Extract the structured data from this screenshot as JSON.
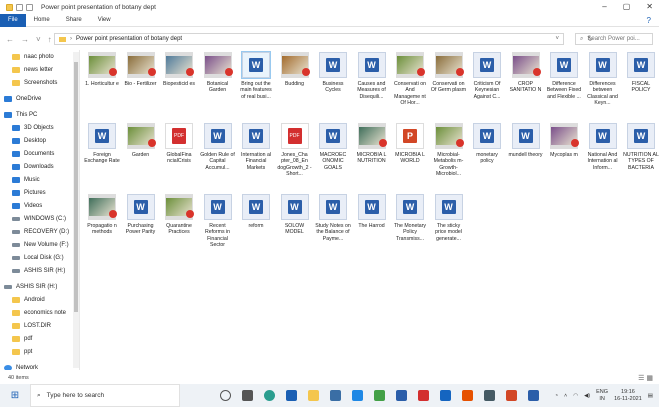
{
  "window": {
    "title": "Power point presentation of botany dept",
    "controls": [
      "–",
      "▢",
      "✕"
    ]
  },
  "ribbon": {
    "tabs": [
      "File",
      "Home",
      "Share",
      "View"
    ],
    "help": "?"
  },
  "address": {
    "path": "Power point presentation of botany dept",
    "search_placeholder": "Search Power poi..."
  },
  "sidebar": {
    "items": [
      {
        "label": "naac photo",
        "icon": "folder-icon"
      },
      {
        "label": "news letter",
        "icon": "folder-icon"
      },
      {
        "label": "Screenshots",
        "icon": "folder-icon"
      },
      {
        "label": "OneDrive",
        "icon": "cloud-icon"
      },
      {
        "label": "This PC",
        "icon": "pc-icon"
      },
      {
        "label": "3D Objects",
        "icon": "objects-icon"
      },
      {
        "label": "Desktop",
        "icon": "desktop-icon"
      },
      {
        "label": "Documents",
        "icon": "documents-icon"
      },
      {
        "label": "Downloads",
        "icon": "download-icon"
      },
      {
        "label": "Music",
        "icon": "music-icon"
      },
      {
        "label": "Pictures",
        "icon": "pictures-icon"
      },
      {
        "label": "Videos",
        "icon": "videos-icon"
      },
      {
        "label": "WINDOWS (C:)",
        "icon": "drive-icon"
      },
      {
        "label": "RECOVERY (D:)",
        "icon": "drive-icon"
      },
      {
        "label": "New Volume (F:)",
        "icon": "drive-icon"
      },
      {
        "label": "Local Disk (G:)",
        "icon": "drive-icon"
      },
      {
        "label": "ASHIS SIR (H:)",
        "icon": "drive-icon"
      },
      {
        "label": "ASHIS SIR (H:)",
        "icon": "drive-icon"
      },
      {
        "label": "Android",
        "icon": "folder-icon"
      },
      {
        "label": "economics note",
        "icon": "folder-icon"
      },
      {
        "label": "LOST.DIR",
        "icon": "folder-icon"
      },
      {
        "label": "pdf",
        "icon": "folder-icon"
      },
      {
        "label": "ppt",
        "icon": "folder-icon"
      },
      {
        "label": "Network",
        "icon": "network-icon"
      }
    ]
  },
  "files": [
    {
      "label": "1. Horticultur e",
      "type": "video"
    },
    {
      "label": "Bio - Fertilizer",
      "type": "video"
    },
    {
      "label": "Biopesticid es",
      "type": "video"
    },
    {
      "label": "Botanical Garden",
      "type": "video"
    },
    {
      "label": "Bring out the main features of real busi...",
      "type": "word"
    },
    {
      "label": "Budding",
      "type": "video"
    },
    {
      "label": "Business Cycles",
      "type": "word"
    },
    {
      "label": "Causes and Measures of Disequili...",
      "type": "word"
    },
    {
      "label": "Conservati on And Manageme nt Of Hor...",
      "type": "video"
    },
    {
      "label": "Conservati on Of Germ plasm",
      "type": "video"
    },
    {
      "label": "Criticism Of Keynesian Against C...",
      "type": "word"
    },
    {
      "label": "CROP SANITATIO N",
      "type": "video"
    },
    {
      "label": "Difference Between Fixed and Flexible ...",
      "type": "word"
    },
    {
      "label": "Differences between Classical and Keyn...",
      "type": "word"
    },
    {
      "label": "FISCAL POLICY",
      "type": "word"
    },
    {
      "label": "Foreign Exchange Rate",
      "type": "word"
    },
    {
      "label": "Garden",
      "type": "video"
    },
    {
      "label": "GlobalFina ncialCrisis",
      "type": "pdf"
    },
    {
      "label": "Golden Rule of Capital Accumul...",
      "type": "word"
    },
    {
      "label": "Internation al Financial Markets",
      "type": "word"
    },
    {
      "label": "Jones_Cha pter_08_En dogGrowth_2 - Short...",
      "type": "pdf"
    },
    {
      "label": "MACROEC ONOMIC GOALS",
      "type": "word"
    },
    {
      "label": "MICROBIA L NUTRITION",
      "type": "video"
    },
    {
      "label": "MICROBIA L WORLD",
      "type": "ppt"
    },
    {
      "label": "Microbial-Metabolis m-Growth-Microbiol...",
      "type": "video"
    },
    {
      "label": "monetary policy",
      "type": "word"
    },
    {
      "label": "mundell theory",
      "type": "word"
    },
    {
      "label": "Mycoplas m",
      "type": "video"
    },
    {
      "label": "National And Internation al Inform...",
      "type": "word"
    },
    {
      "label": "NUTRITION AL TYPES OF BACTERIA",
      "type": "word"
    },
    {
      "label": "Propagatio n methods",
      "type": "video"
    },
    {
      "label": "Purchasing Power Parity",
      "type": "word"
    },
    {
      "label": "Quarantine Practices",
      "type": "video"
    },
    {
      "label": "Recent Reforms in Financial Sector",
      "type": "word"
    },
    {
      "label": "reform",
      "type": "word"
    },
    {
      "label": "SOLOW MODEL",
      "type": "word"
    },
    {
      "label": "Study Notes on the Balance of Payme...",
      "type": "word"
    },
    {
      "label": "The Harrod",
      "type": "word"
    },
    {
      "label": "The Monetary Policy Transmiss...",
      "type": "word"
    },
    {
      "label": "The sticky price model generate...",
      "type": "word"
    }
  ],
  "status": {
    "count": "40 items"
  },
  "taskbar": {
    "search_placeholder": "Type here to search",
    "lang1": "ENG",
    "lang2": "IN",
    "time": "19:16",
    "date": "16-11-2021"
  },
  "colors": {
    "accent": "#1a5fb4",
    "word": "#2b5ea9",
    "pdf": "#d32f2f",
    "ppt": "#d24726",
    "video_play": "#d9342b"
  }
}
